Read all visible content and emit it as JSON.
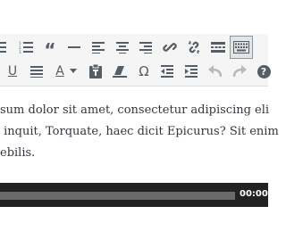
{
  "toolbar": {
    "row1": [
      {
        "name": "bullet-list-icon",
        "label": ""
      },
      {
        "name": "numbered-list-icon",
        "label": "1 2 3"
      },
      {
        "name": "blockquote-icon",
        "label": "“"
      },
      {
        "name": "horizontal-line-icon",
        "label": ""
      },
      {
        "name": "align-left-icon",
        "label": ""
      },
      {
        "name": "align-center-icon",
        "label": ""
      },
      {
        "name": "align-right-icon",
        "label": ""
      },
      {
        "name": "insert-link-icon",
        "label": ""
      },
      {
        "name": "remove-link-icon",
        "label": ""
      },
      {
        "name": "read-more-icon",
        "label": ""
      },
      {
        "name": "toolbar-toggle-icon",
        "label": ""
      }
    ],
    "row2": [
      {
        "name": "underline-icon",
        "label": "U"
      },
      {
        "name": "justify-icon",
        "label": ""
      },
      {
        "name": "text-color-icon",
        "label": "A"
      },
      {
        "name": "paste-as-text-icon",
        "label": ""
      },
      {
        "name": "clear-formatting-icon",
        "label": ""
      },
      {
        "name": "special-character-icon",
        "label": "Ω"
      },
      {
        "name": "decrease-indent-icon",
        "label": ""
      },
      {
        "name": "increase-indent-icon",
        "label": ""
      },
      {
        "name": "undo-icon",
        "label": ""
      },
      {
        "name": "redo-icon",
        "label": ""
      },
      {
        "name": "help-icon",
        "label": "?"
      }
    ]
  },
  "content": {
    "line1": "sum dolor sit amet, consectetur adipiscing eli",
    "line2": " inquit, Torquate, haec dicit Epicurus? Sit enim",
    "line3": "ebilis."
  },
  "player": {
    "time": "00:00"
  },
  "colors": {
    "toolbar_bg": "#f5f5f5",
    "icon": "#555d66",
    "icon_disabled": "#b4b9be",
    "text": "#32373c",
    "player_bg": "#222222",
    "player_rail": "#6a6a6a"
  }
}
